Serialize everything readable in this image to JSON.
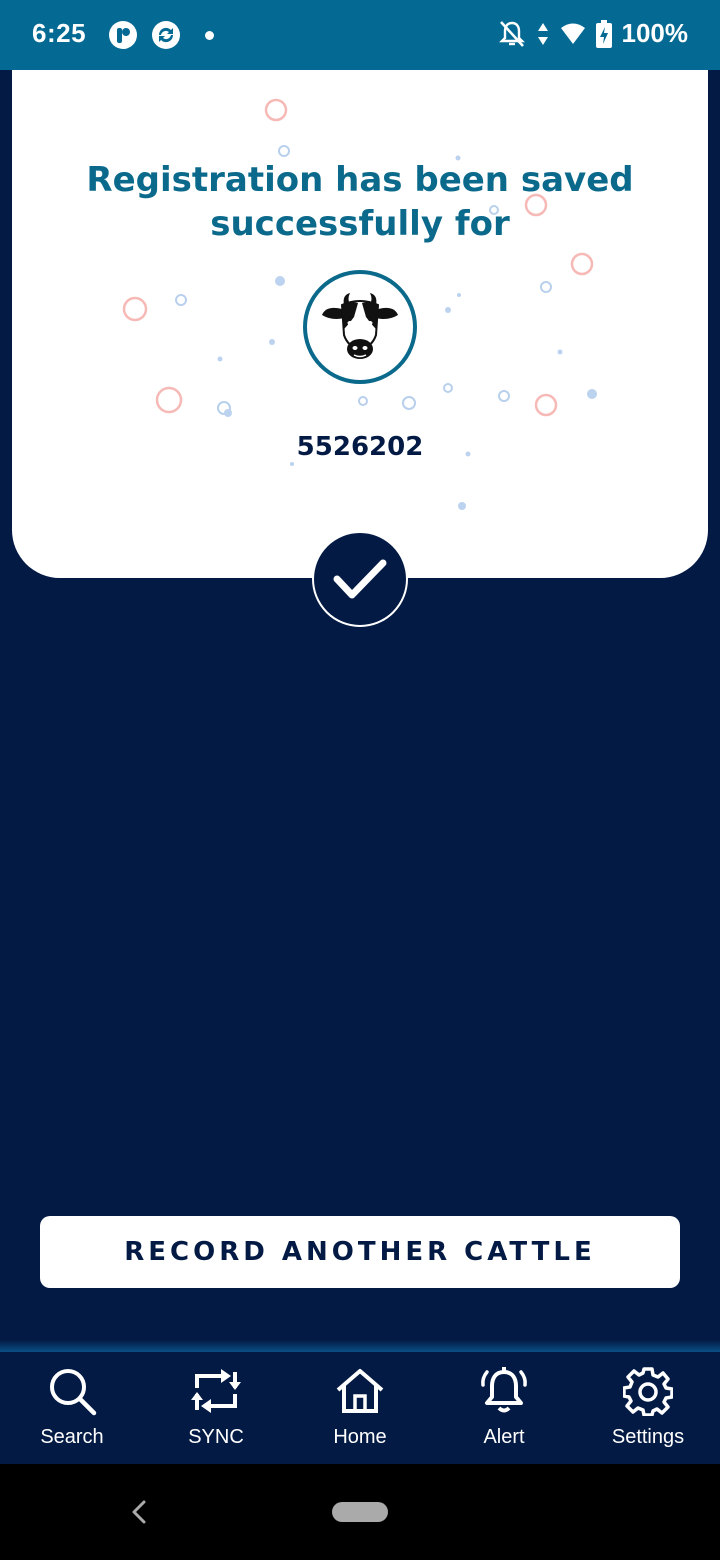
{
  "status_bar": {
    "time": "6:25",
    "battery": "100%",
    "background": "#046a94"
  },
  "card": {
    "title_line1": "Registration has been saved",
    "title_line2": "successfully for",
    "tag_number": "5526202",
    "icon": "cow-icon",
    "title_color": "#0b6a8c"
  },
  "success_icon": "check-icon",
  "record_button": {
    "label": "RECORD ANOTHER CATTLE"
  },
  "bottom_nav": {
    "items": [
      {
        "label": "Search",
        "icon": "search-icon"
      },
      {
        "label": "SYNC",
        "icon": "sync-icon"
      },
      {
        "label": "Home",
        "icon": "home-icon"
      },
      {
        "label": "Alert",
        "icon": "bell-icon"
      },
      {
        "label": "Settings",
        "icon": "gear-icon"
      }
    ]
  },
  "colors": {
    "background": "#031a45",
    "accent": "#0b6a8c"
  }
}
